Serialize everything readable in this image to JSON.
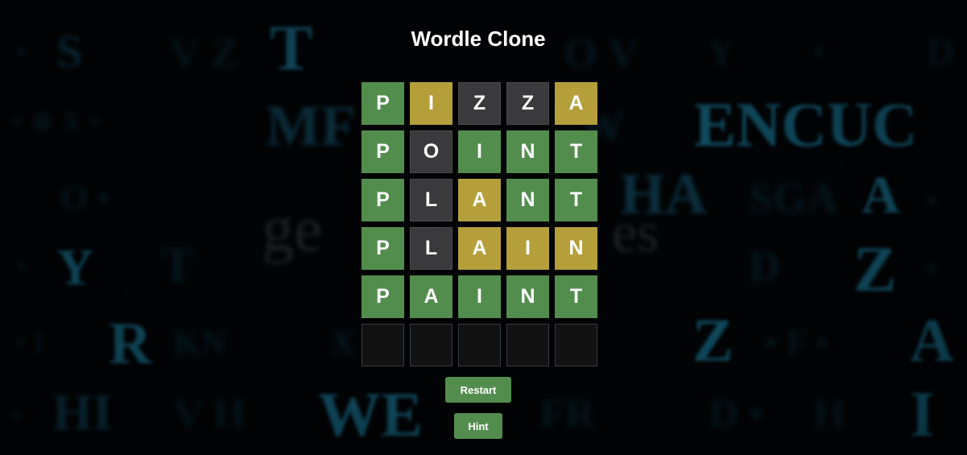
{
  "app": {
    "title": "Wordle Clone"
  },
  "board": {
    "rows": [
      [
        {
          "letter": "P",
          "state": "correct"
        },
        {
          "letter": "I",
          "state": "present"
        },
        {
          "letter": "Z",
          "state": "absent"
        },
        {
          "letter": "Z",
          "state": "absent"
        },
        {
          "letter": "A",
          "state": "present"
        }
      ],
      [
        {
          "letter": "P",
          "state": "correct"
        },
        {
          "letter": "O",
          "state": "absent"
        },
        {
          "letter": "I",
          "state": "correct"
        },
        {
          "letter": "N",
          "state": "correct"
        },
        {
          "letter": "T",
          "state": "correct"
        }
      ],
      [
        {
          "letter": "P",
          "state": "correct"
        },
        {
          "letter": "L",
          "state": "absent"
        },
        {
          "letter": "A",
          "state": "present"
        },
        {
          "letter": "N",
          "state": "correct"
        },
        {
          "letter": "T",
          "state": "correct"
        }
      ],
      [
        {
          "letter": "P",
          "state": "correct"
        },
        {
          "letter": "L",
          "state": "absent"
        },
        {
          "letter": "A",
          "state": "present"
        },
        {
          "letter": "I",
          "state": "present"
        },
        {
          "letter": "N",
          "state": "present"
        }
      ],
      [
        {
          "letter": "P",
          "state": "correct"
        },
        {
          "letter": "A",
          "state": "correct"
        },
        {
          "letter": "I",
          "state": "correct"
        },
        {
          "letter": "N",
          "state": "correct"
        },
        {
          "letter": "T",
          "state": "correct"
        }
      ],
      [
        {
          "letter": "",
          "state": "empty"
        },
        {
          "letter": "",
          "state": "empty"
        },
        {
          "letter": "",
          "state": "empty"
        },
        {
          "letter": "",
          "state": "empty"
        },
        {
          "letter": "",
          "state": "empty"
        }
      ]
    ]
  },
  "buttons": {
    "restart_label": "Restart",
    "hint_label": "Hint"
  },
  "colors": {
    "correct": "#538d4e",
    "present": "#b59f3b",
    "absent": "#3a3a3c",
    "empty": "#121212",
    "background_letters": "#1b6f8f"
  }
}
